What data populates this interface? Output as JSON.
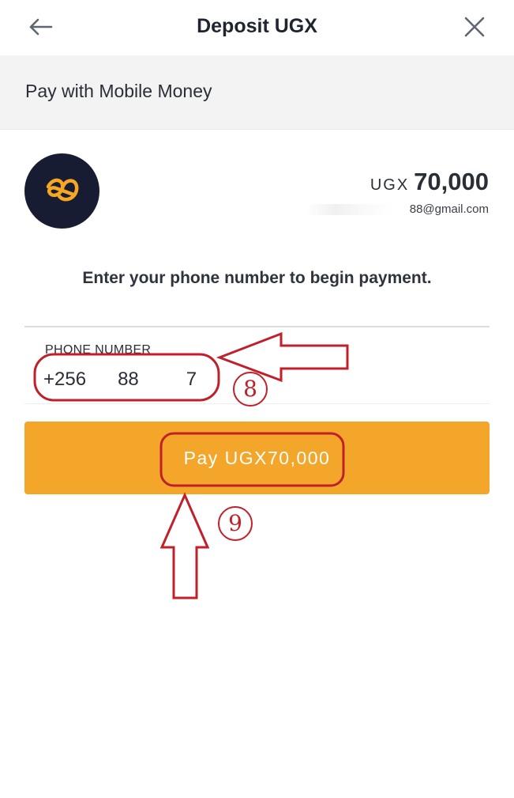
{
  "header": {
    "title": "Deposit UGX",
    "back_icon": "arrow-left-icon",
    "close_icon": "close-icon"
  },
  "subheader": {
    "label": "Pay with Mobile Money"
  },
  "merchant": {
    "logo_icon": "butterfly-logo-icon",
    "currency": "UGX",
    "amount": "70,000",
    "email": "88@gmail.com"
  },
  "instruction": "Enter your phone number to begin payment.",
  "phone": {
    "label": "PHONE NUMBER",
    "value": "+256      88         7"
  },
  "pay_button": {
    "label": "Pay UGX70,000"
  },
  "annotations": {
    "step_8": "8",
    "step_9": "9"
  },
  "colors": {
    "accent": "#f4a62a",
    "logo_bg": "#171c33",
    "annotation": "#c0202a",
    "subbar_bg": "#f3f3f4"
  }
}
